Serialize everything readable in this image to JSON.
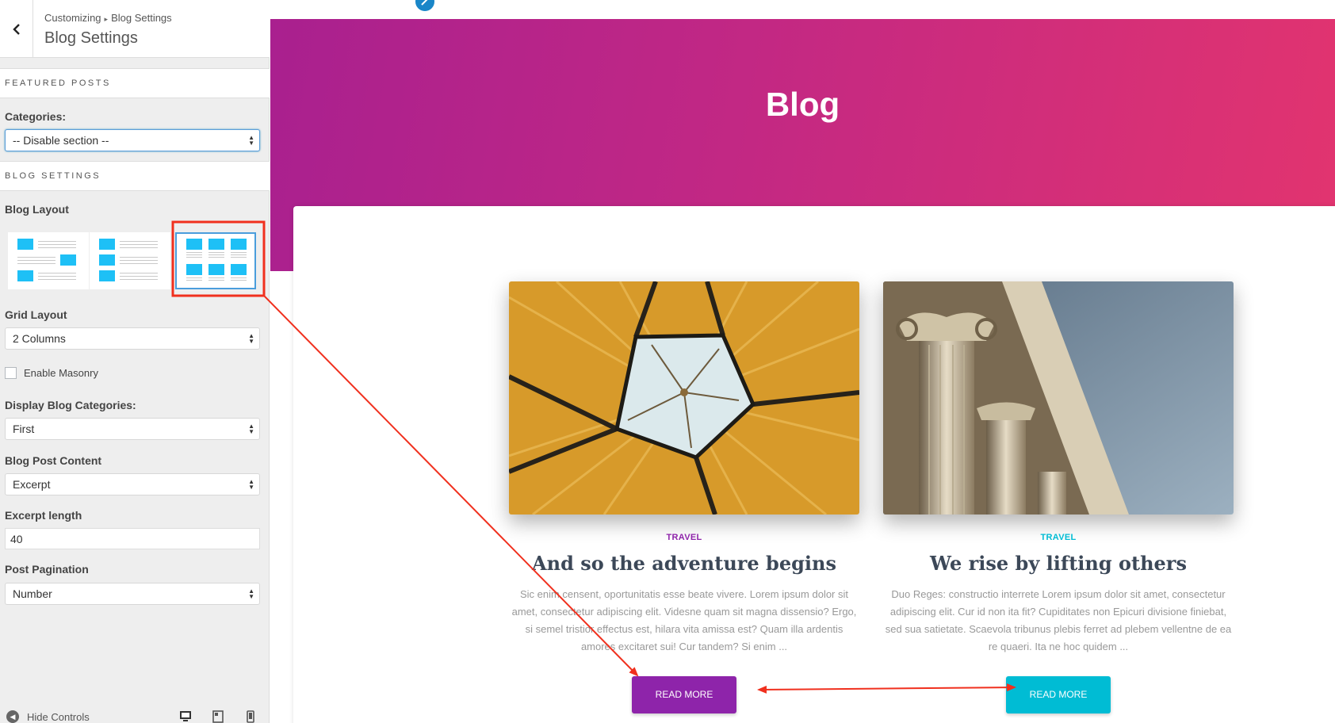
{
  "sidebar": {
    "breadcrumb_parent": "Customizing",
    "breadcrumb_sep": "▸",
    "breadcrumb_child": "Blog Settings",
    "title": "Blog Settings",
    "featured_section": "FEATURED POSTS",
    "categories_label": "Categories:",
    "categories_value": "-- Disable section --",
    "blog_section": "BLOG SETTINGS",
    "blog_layout_label": "Blog Layout",
    "grid_layout_label": "Grid Layout",
    "grid_layout_value": "2 Columns",
    "masonry_label": "Enable Masonry",
    "masonry_checked": false,
    "display_categories_label": "Display Blog Categories:",
    "display_categories_value": "First",
    "post_content_label": "Blog Post Content",
    "post_content_value": "Excerpt",
    "excerpt_length_label": "Excerpt length",
    "excerpt_length_value": "40",
    "pagination_label": "Post Pagination",
    "pagination_value": "Number",
    "hide_controls": "Hide Controls",
    "selected_layout": "grid"
  },
  "preview": {
    "hero_title": "Blog",
    "hero_gradient": [
      "#a9208f",
      "#e2346f"
    ],
    "posts": [
      {
        "category": "TRAVEL",
        "title": "And so the adventure begins",
        "excerpt": "Sic enim censent, oportunitatis esse beate vivere. Lorem ipsum dolor sit amet, consectetur adipiscing elit. Videsne quam sit magna dissensio? Ergo, si semel tristior effectus est, hilara vita amissa est? Quam illa ardentis amores excitaret sui! Cur tandem? Si enim ...",
        "button": "READ MORE",
        "accent": "#8e24aa"
      },
      {
        "category": "TRAVEL",
        "title": "We rise by lifting others",
        "excerpt": "Duo Reges: constructio interrete Lorem ipsum dolor sit amet, consectetur adipiscing elit. Cur id non ita fit? Cupiditates non Epicuri divisione finiebat, sed sua satietate. Scaevola tribunus plebis ferret ad plebem vellentne de ea re quaeri. Ita ne hoc quidem ...",
        "button": "READ MORE",
        "accent": "#00bcd4"
      }
    ]
  },
  "annotation_color": "#f0301e"
}
